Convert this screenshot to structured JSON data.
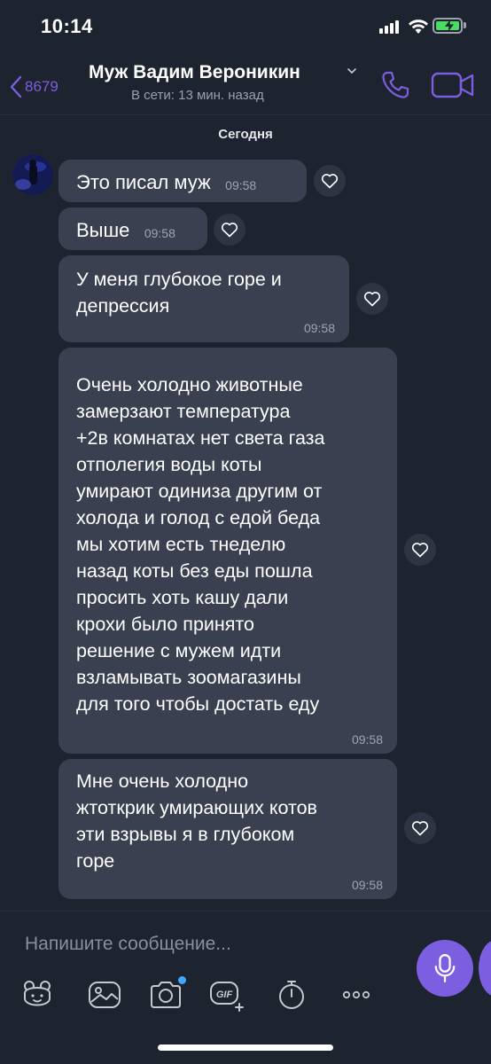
{
  "status_bar": {
    "time": "10:14"
  },
  "header": {
    "back_count": "8679",
    "contact_name": "Муж Вадим Вероникин",
    "contact_status": "В сети: 13 мин. назад"
  },
  "chat": {
    "date_label": "Сегодня",
    "messages": [
      {
        "text": "Это писал муж",
        "time": "09:58"
      },
      {
        "text": "Выше",
        "time": "09:58"
      },
      {
        "text": "У меня глубокое горе и\nдепрессия",
        "time": "09:58"
      },
      {
        "text": "Очень холодно  животные\nзамерзают температура\n+2в комнатах нет света газа\nотполегия воды коты\nумирают одиниза другим от\nхолода и голод с едой беда\nмы хотим есть тнеделю\nназад коты без еды пошла\nпросить хоть кашу дали\nкрохи было принято\nрешение с мужем идти\nвзламывать зоомагазины\nдля того чтобы достать еду",
        "time": "09:58"
      },
      {
        "text": "Мне очень холодно\nжтоткрик умирающих котов\nэти взрывы я в глубоком\nгоре",
        "time": "09:58"
      }
    ]
  },
  "composer": {
    "placeholder": "Напишите сообщение...",
    "toolbar_icons": [
      "sticker-icon",
      "gallery-icon",
      "camera-icon",
      "gif-icon",
      "timer-icon",
      "more-icon"
    ]
  },
  "colors": {
    "background": "#1e2330",
    "bubble": "#3b4050",
    "accent": "#7b5fe0",
    "muted_text": "#9ea3ae",
    "notification_dot": "#3fa8ff"
  }
}
